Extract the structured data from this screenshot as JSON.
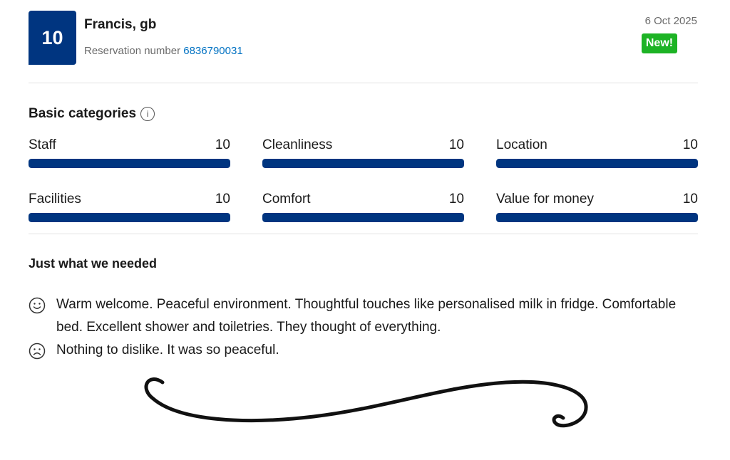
{
  "review": {
    "score": "10",
    "reviewer": "Francis, gb",
    "reservation_label": "Reservation number",
    "reservation_number": "6836790031",
    "date": "6 Oct 2025",
    "new_badge": "New!"
  },
  "categories_section": {
    "title": "Basic categories",
    "info_icon": "info-icon",
    "items": [
      {
        "label": "Staff",
        "value": "10",
        "fraction": 1.0
      },
      {
        "label": "Cleanliness",
        "value": "10",
        "fraction": 1.0
      },
      {
        "label": "Location",
        "value": "10",
        "fraction": 1.0
      },
      {
        "label": "Facilities",
        "value": "10",
        "fraction": 1.0
      },
      {
        "label": "Comfort",
        "value": "10",
        "fraction": 1.0
      },
      {
        "label": "Value for money",
        "value": "10",
        "fraction": 1.0
      }
    ]
  },
  "review_body": {
    "title": "Just what we needed",
    "positive_icon": "smiley-face-icon",
    "positive": "Warm welcome. Peaceful environment. Thoughtful touches like personalised milk in fridge. Comfortable bed. Excellent shower and toiletries. They thought of everything.",
    "negative_icon": "sad-face-icon",
    "negative": "Nothing to dislike. It was so peaceful."
  },
  "colors": {
    "brand_blue": "#003580",
    "link_blue": "#0071c2",
    "new_green": "#1db325"
  }
}
